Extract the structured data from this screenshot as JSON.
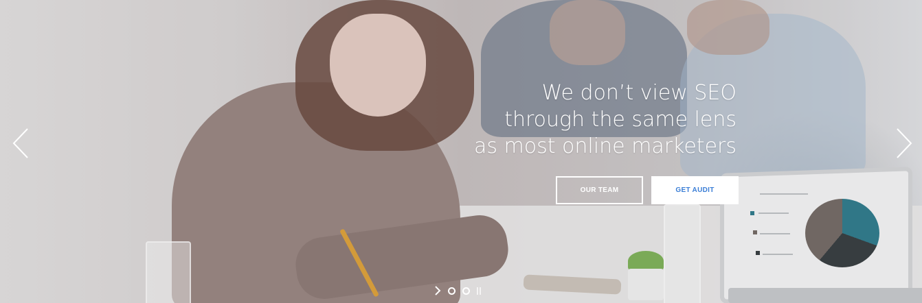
{
  "slider": {
    "headline": [
      "We don’t view SEO",
      "through the same lens",
      "as most online marketers"
    ],
    "buttons": {
      "team_label": "OUR TEAM",
      "audit_label": "GET AUDIT"
    },
    "icons": {
      "prev": "chevron-left-icon",
      "next": "chevron-right-icon",
      "play": "play-next-icon",
      "pause": "pause-icon"
    },
    "pagination": {
      "slide_count": 2
    },
    "colors": {
      "headline": "#ffffff",
      "audit_button_text": "#3b7ed6",
      "outline_button": "#ffffff"
    }
  }
}
